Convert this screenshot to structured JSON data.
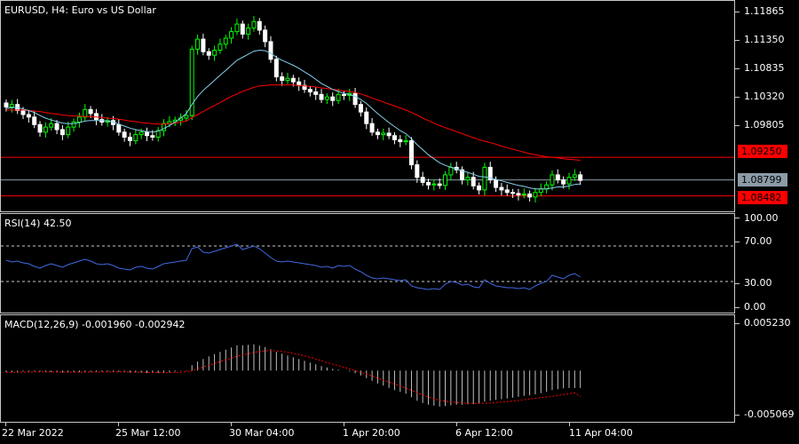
{
  "main": {
    "title": "EURUSD, H4:  Euro vs US Dollar",
    "symbol": "EURUSD",
    "timeframe": "H4",
    "price_ticks": [
      "1.11865",
      "1.11350",
      "1.10835",
      "1.10320",
      "1.09805",
      "1.08799"
    ],
    "price_min": 1.0828,
    "price_max": 1.1222,
    "levels": [
      {
        "price": 1.0925,
        "label": "1.09250",
        "color": "#ff0000"
      },
      {
        "price": 1.0848,
        "label": "1.08482",
        "color": "#ff0000"
      },
      {
        "price": 1.08799,
        "label": "1.08799",
        "color": "#8c9ba6"
      }
    ],
    "colors": {
      "bull": "#00ff00",
      "bear": "#ffffff",
      "ma_fast": "#87ceeb",
      "ma_slow": "#ff0000"
    }
  },
  "rsi": {
    "title": "RSI(14) 42.50",
    "ticks": [
      "100.00",
      "70.00",
      "30.00",
      "0.00"
    ],
    "levels": [
      70,
      30
    ],
    "color": "#4169e1"
  },
  "macd": {
    "title": "MACD(12,26,9) -0.001960 -0.002942",
    "ticks": [
      "0.005230",
      "-0.005069"
    ],
    "min": -0.005069,
    "max": 0.00523,
    "colors": {
      "histogram": "#c0c0c0",
      "signal": "#ff0000"
    }
  },
  "time_axis": {
    "labels": [
      "22 Mar 2022",
      "25 Mar 12:00",
      "30 Mar 04:00",
      "1 Apr 20:00",
      "6 Apr 12:00",
      "11 Apr 04:00"
    ]
  },
  "chart_data": [
    {
      "type": "candlestick",
      "title": "EURUSD, H4:  Euro vs US Dollar",
      "x": [
        "22 Mar 2022",
        "25 Mar 12:00",
        "30 Mar 04:00",
        "1 Apr 20:00",
        "6 Apr 12:00",
        "11 Apr 04:00"
      ],
      "closes": [
        1.1025,
        1.103,
        1.1018,
        1.101,
        1.1005,
        1.099,
        1.0975,
        1.0985,
        1.0992,
        1.098,
        1.097,
        1.0985,
        1.0995,
        1.1005,
        1.102,
        1.1012,
        1.1,
        1.0995,
        1.0998,
        1.099,
        1.0975,
        1.0965,
        1.0958,
        1.097,
        1.0975,
        1.0968,
        1.0965,
        1.0978,
        1.0992,
        1.0996,
        1.0999,
        1.1003,
        1.1008,
        1.114,
        1.116,
        1.1135,
        1.1128,
        1.1138,
        1.115,
        1.1162,
        1.1175,
        1.119,
        1.117,
        1.1182,
        1.1195,
        1.1178,
        1.1155,
        1.112,
        1.1085,
        1.1078,
        1.1082,
        1.1075,
        1.1068,
        1.106,
        1.1055,
        1.105,
        1.104,
        1.1045,
        1.1038,
        1.105,
        1.1048,
        1.1052,
        1.103,
        1.1015,
        1.0992,
        1.0975,
        1.097,
        1.0973,
        1.0968,
        1.096,
        1.0956,
        1.0958,
        1.091,
        1.0885,
        1.0875,
        1.087,
        1.0872,
        1.0869,
        1.089,
        1.0905,
        1.09,
        1.088,
        1.0885,
        1.0868,
        1.086,
        1.0905,
        1.088,
        1.0865,
        1.086,
        1.0855,
        1.0853,
        1.085,
        1.0852,
        1.0846,
        1.0855,
        1.0862,
        1.087,
        1.089,
        1.088,
        1.0872,
        1.0885,
        1.089,
        1.0879
      ],
      "ma_fast": [
        1.1022,
        1.1024,
        1.1024,
        1.1021,
        1.1018,
        1.1014,
        1.1008,
        1.1003,
        1.0999,
        1.0996,
        1.0993,
        1.0992,
        1.0992,
        1.0994,
        1.0997,
        1.0998,
        1.0998,
        1.0998,
        1.0997,
        1.0995,
        1.0991,
        1.0987,
        1.0983,
        1.098,
        1.0978,
        1.0976,
        1.0975,
        1.0977,
        1.0982,
        1.0988,
        1.0995,
        1.1003,
        1.1012,
        1.103,
        1.1046,
        1.1058,
        1.1068,
        1.1078,
        1.1088,
        1.1098,
        1.1108,
        1.1118,
        1.1124,
        1.113,
        1.1136,
        1.1138,
        1.1137,
        1.1132,
        1.1124,
        1.1118,
        1.1113,
        1.1108,
        1.1102,
        1.1095,
        1.1088,
        1.108,
        1.1072,
        1.1066,
        1.106,
        1.1056,
        1.1052,
        1.105,
        1.1046,
        1.104,
        1.1032,
        1.1022,
        1.1012,
        1.1003,
        1.0994,
        1.0986,
        1.0978,
        1.0972,
        1.0962,
        1.095,
        1.094,
        1.093,
        1.0922,
        1.0914,
        1.0909,
        1.0905,
        1.0902,
        1.0898,
        1.0895,
        1.0891,
        1.0887,
        1.0886,
        1.0884,
        1.0881,
        1.0878,
        1.0875,
        1.0872,
        1.0869,
        1.0867,
        1.0864,
        1.0862,
        1.0862,
        1.0862,
        1.0864,
        1.0866,
        1.0866,
        1.0868,
        1.0871,
        1.0872
      ],
      "ma_slow": [
        1.1019,
        1.1019,
        1.1019,
        1.1019,
        1.1018,
        1.1017,
        1.1016,
        1.1014,
        1.1012,
        1.1011,
        1.1009,
        1.1008,
        1.1007,
        1.1007,
        1.1006,
        1.1006,
        1.1005,
        1.1004,
        1.1003,
        1.1002,
        1.1001,
        1.0999,
        1.0997,
        1.0996,
        1.0994,
        1.0993,
        1.0992,
        1.0991,
        1.0991,
        1.0992,
        1.0993,
        1.0995,
        1.0997,
        1.1004,
        1.101,
        1.1016,
        1.1022,
        1.1028,
        1.1034,
        1.104,
        1.1046,
        1.1051,
        1.1056,
        1.106,
        1.1064,
        1.1067,
        1.1068,
        1.1069,
        1.1069,
        1.1069,
        1.1069,
        1.1069,
        1.1068,
        1.1067,
        1.1066,
        1.1065,
        1.1063,
        1.1062,
        1.106,
        1.1059,
        1.1057,
        1.1056,
        1.1054,
        1.1051,
        1.1047,
        1.1043,
        1.1039,
        1.1035,
        1.1031,
        1.1027,
        1.1023,
        1.1019,
        1.1014,
        1.1009,
        1.1003,
        1.0998,
        1.0993,
        1.0988,
        1.0984,
        1.098,
        1.0976,
        1.0972,
        1.0968,
        1.0964,
        1.096,
        1.0957,
        1.0954,
        1.0951,
        1.0947,
        1.0944,
        1.0941,
        1.0938,
        1.0935,
        1.0932,
        1.093,
        1.0928,
        1.0926,
        1.0925,
        1.0924,
        1.0922,
        1.0921,
        1.092,
        1.0919
      ]
    },
    {
      "type": "line",
      "title": "RSI(14) 42.50",
      "ylim": [
        0,
        100
      ],
      "values": [
        54,
        52,
        53,
        51,
        50,
        47,
        45,
        48,
        50,
        48,
        46,
        49,
        51,
        53,
        55,
        53,
        50,
        49,
        50,
        48,
        45,
        44,
        43,
        46,
        47,
        45,
        44,
        47,
        50,
        51,
        52,
        53,
        54,
        67,
        69,
        63,
        62,
        64,
        66,
        68,
        70,
        72,
        66,
        68,
        70,
        67,
        62,
        57,
        53,
        52,
        53,
        52,
        51,
        50,
        49,
        48,
        46,
        47,
        45,
        48,
        47,
        48,
        44,
        41,
        37,
        34,
        33,
        34,
        33,
        32,
        31,
        32,
        25,
        23,
        22,
        21,
        22,
        21,
        27,
        30,
        29,
        26,
        27,
        24,
        23,
        32,
        28,
        25,
        24,
        23,
        23,
        22,
        23,
        21,
        25,
        28,
        30,
        37,
        35,
        33,
        37,
        39,
        35
      ]
    },
    {
      "type": "bar",
      "title": "MACD(12,26,9) -0.001960 -0.002942",
      "ylim": [
        -0.005069,
        0.00523
      ],
      "values": [
        -0.0002,
        -0.00018,
        -0.00015,
        -0.00012,
        -0.0001,
        -0.0001,
        -0.00012,
        -0.00015,
        -0.00018,
        -0.0002,
        -0.00022,
        -0.00022,
        -0.0002,
        -0.00018,
        -0.00015,
        -0.00013,
        -0.00012,
        -0.00012,
        -0.00012,
        -0.00013,
        -0.00015,
        -0.00018,
        -0.00022,
        -0.00024,
        -0.00026,
        -0.00028,
        -0.00029,
        -0.00028,
        -0.00025,
        -0.0002,
        -0.00012,
        -4e-05,
        5e-05,
        0.0006,
        0.001,
        0.0013,
        0.0016,
        0.00185,
        0.0021,
        0.00235,
        0.0026,
        0.00285,
        0.00285,
        0.0029,
        0.00295,
        0.0028,
        0.00265,
        0.0024,
        0.0021,
        0.0019,
        0.0017,
        0.0015,
        0.0013,
        0.0011,
        0.0009,
        0.0007,
        0.0005,
        0.00035,
        0.0002,
        0.0001,
        0.0,
        -0.0001,
        -0.0003,
        -0.00055,
        -0.00085,
        -0.00115,
        -0.00145,
        -0.0017,
        -0.00195,
        -0.0022,
        -0.0024,
        -0.0026,
        -0.003,
        -0.0034,
        -0.00365,
        -0.00385,
        -0.00395,
        -0.00405,
        -0.004,
        -0.0039,
        -0.00385,
        -0.00385,
        -0.0038,
        -0.00378,
        -0.0037,
        -0.0035,
        -0.0034,
        -0.0033,
        -0.00322,
        -0.00315,
        -0.00305,
        -0.00295,
        -0.00285,
        -0.00278,
        -0.00268,
        -0.00255,
        -0.0024,
        -0.0022,
        -0.0021,
        -0.002,
        -0.00196,
        -0.00196,
        -0.00196
      ],
      "signal": [
        -0.0002,
        -0.0002,
        -0.00019,
        -0.00018,
        -0.00016,
        -0.00015,
        -0.00015,
        -0.00015,
        -0.00015,
        -0.00016,
        -0.00017,
        -0.00018,
        -0.00018,
        -0.00018,
        -0.00018,
        -0.00017,
        -0.00016,
        -0.00015,
        -0.00015,
        -0.00014,
        -0.00014,
        -0.00015,
        -0.00016,
        -0.00018,
        -0.00019,
        -0.00021,
        -0.00022,
        -0.00023,
        -0.00024,
        -0.00023,
        -0.00021,
        -0.00018,
        -0.00013,
        -1e-05,
        0.0002,
        0.0004,
        0.0006,
        0.0008,
        0.001,
        0.0012,
        0.0014,
        0.0016,
        0.00175,
        0.0019,
        0.00205,
        0.00215,
        0.00222,
        0.00225,
        0.00222,
        0.00215,
        0.00205,
        0.00195,
        0.0018,
        0.00165,
        0.0015,
        0.0013,
        0.0011,
        0.0009,
        0.00072,
        0.00055,
        0.00038,
        0.0002,
        0.0,
        -0.0002,
        -0.0004,
        -0.00062,
        -0.00085,
        -0.00108,
        -0.0013,
        -0.00152,
        -0.00175,
        -0.00198,
        -0.00222,
        -0.0025,
        -0.00275,
        -0.00298,
        -0.00318,
        -0.00335,
        -0.00345,
        -0.00353,
        -0.0036,
        -0.00365,
        -0.00368,
        -0.0037,
        -0.0037,
        -0.00368,
        -0.00365,
        -0.0036,
        -0.00355,
        -0.0035,
        -0.00343,
        -0.00336,
        -0.00328,
        -0.0032,
        -0.00312,
        -0.00305,
        -0.00298,
        -0.0029,
        -0.0028,
        -0.0027,
        -0.0026,
        -0.0025,
        -0.00294
      ]
    }
  ]
}
